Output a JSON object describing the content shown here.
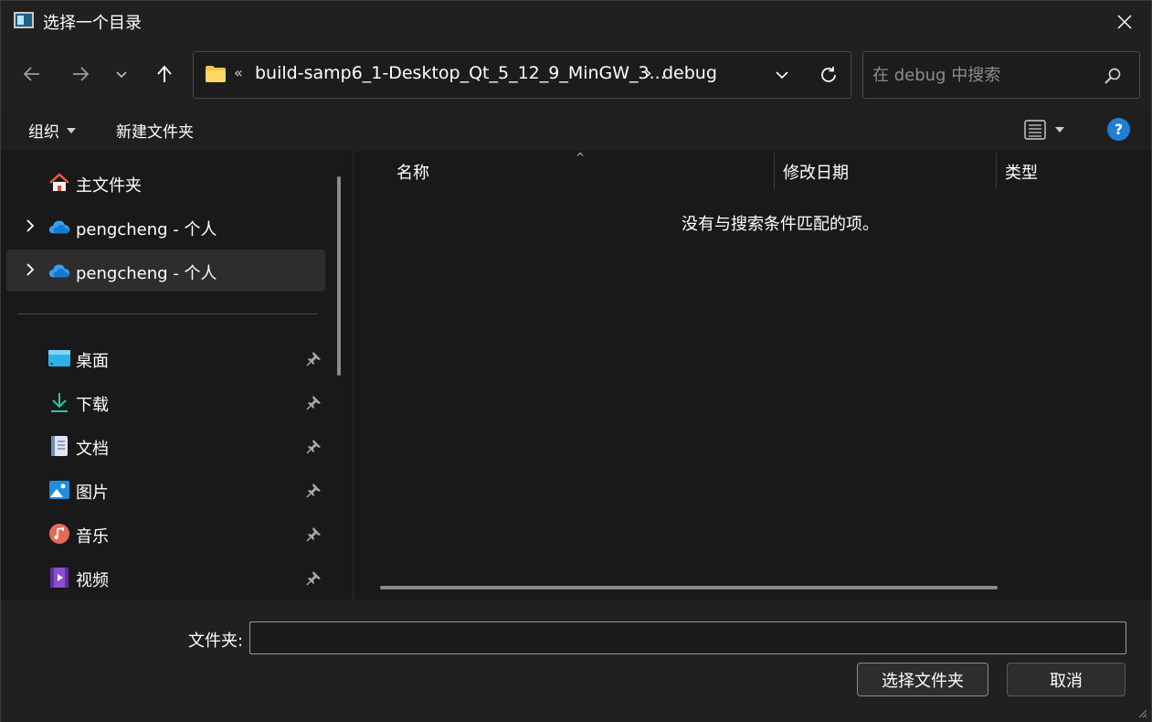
{
  "window": {
    "title": "选择一个目录"
  },
  "address": {
    "overflow": "«",
    "crumbs": [
      "build-samp6_1-Desktop_Qt_5_12_9_MinGW_3...",
      "debug"
    ],
    "separator": "›"
  },
  "search": {
    "placeholder": "在 debug 中搜索"
  },
  "toolbar": {
    "organize": "组织",
    "new_folder": "新建文件夹",
    "help": "?"
  },
  "sidebar": {
    "items": [
      {
        "label": "主文件夹",
        "icon": "home-icon"
      },
      {
        "label": "pengcheng - 个人",
        "icon": "onedrive-cloud-icon"
      },
      {
        "label": "pengcheng - 个人",
        "icon": "onedrive-cloud-icon",
        "selected": true
      }
    ],
    "quick_access": [
      {
        "label": "桌面",
        "icon": "desktop-icon"
      },
      {
        "label": "下载",
        "icon": "download-icon"
      },
      {
        "label": "文档",
        "icon": "document-icon"
      },
      {
        "label": "图片",
        "icon": "pictures-icon"
      },
      {
        "label": "音乐",
        "icon": "music-icon"
      },
      {
        "label": "视频",
        "icon": "video-icon"
      }
    ]
  },
  "content": {
    "columns": [
      "名称",
      "修改日期",
      "类型"
    ],
    "empty_message": "没有与搜索条件匹配的项。"
  },
  "bottom": {
    "folder_label": "文件夹:",
    "folder_value": "",
    "select_button": "选择文件夹",
    "cancel_button": "取消"
  },
  "colors": {
    "background": "#202020",
    "pane": "#191919",
    "accent": "#1d7fd6",
    "folder": "#f5c24b"
  }
}
